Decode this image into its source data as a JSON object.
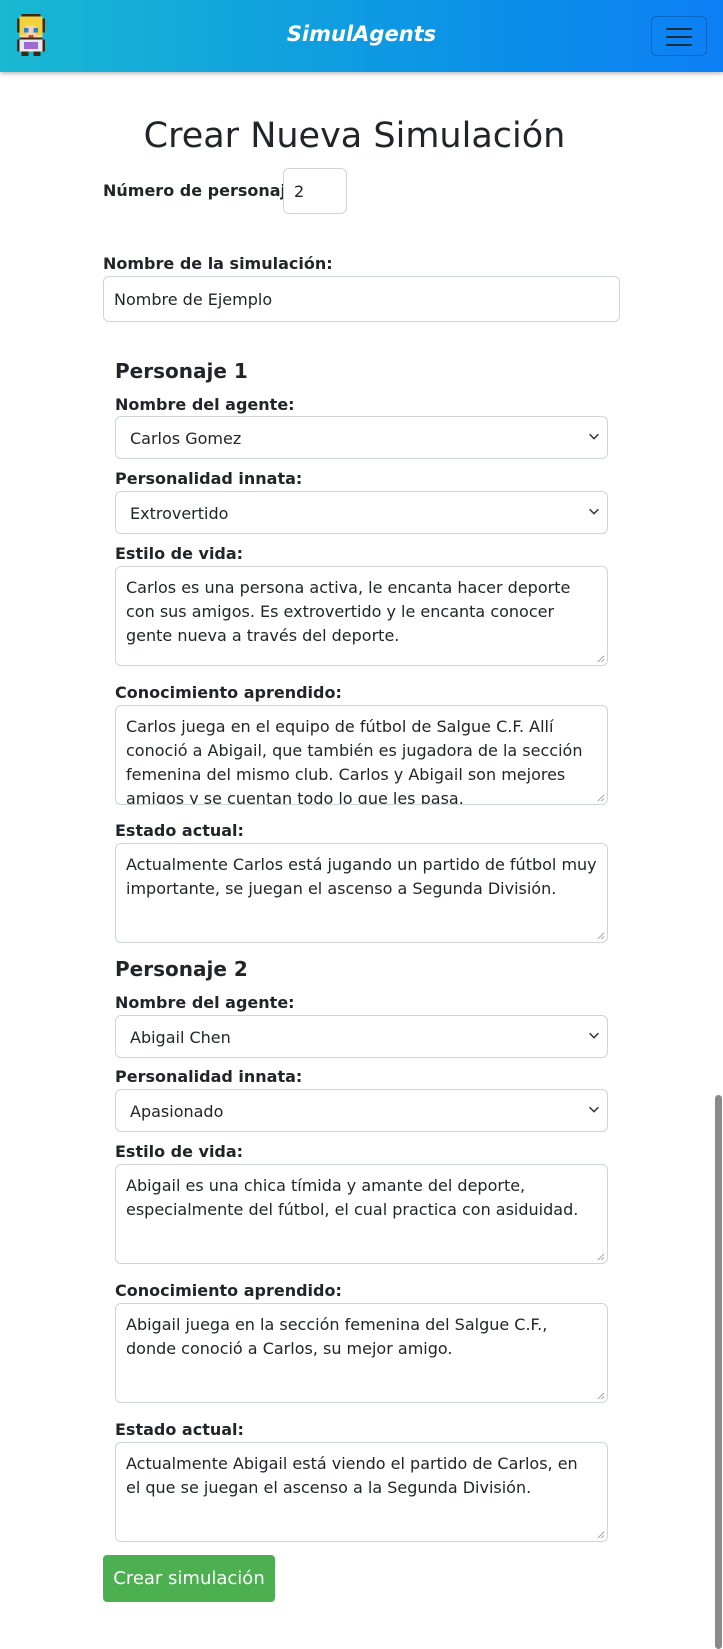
{
  "navbar": {
    "brand": "SimulAgents",
    "logo_icon": "pixel-character-avatar-icon",
    "menu_icon": "hamburger-menu-icon",
    "accent_start": "#1ab8d2",
    "accent_end": "#0d7ff6"
  },
  "page": {
    "title": "Crear Nueva Simulación"
  },
  "form": {
    "count_label": "Número de personajes:",
    "count_value": "2",
    "name_label": "Nombre de la simulación:",
    "name_value": "Nombre de Ejemplo",
    "field_labels": {
      "agent_name": "Nombre del agente:",
      "personality": "Personalidad innata:",
      "lifestyle": "Estilo de vida:",
      "knowledge": "Conocimiento aprendido:",
      "status": "Estado actual:"
    },
    "characters": [
      {
        "title": "Personaje 1",
        "agent_name": "Carlos Gomez",
        "personality": "Extrovertido",
        "lifestyle": "Carlos es una persona activa, le encanta hacer deporte con sus amigos. Es extrovertido y le encanta conocer gente nueva a través del deporte.",
        "knowledge": "Carlos juega en el equipo de fútbol de Salgue C.F. Allí conoció a Abigail, que también es jugadora de la sección femenina del mismo club. Carlos y Abigail son mejores amigos y se cuentan todo lo que les pasa.",
        "status": "Actualmente Carlos está jugando un partido de fútbol muy importante, se juegan el ascenso a Segunda División."
      },
      {
        "title": "Personaje 2",
        "agent_name": "Abigail Chen",
        "personality": "Apasionado",
        "lifestyle": "Abigail es una chica tímida y amante del deporte, especialmente del fútbol, el cual practica con asiduidad.",
        "knowledge": "Abigail juega en la sección femenina del Salgue C.F., donde conoció a Carlos, su mejor amigo.",
        "status": "Actualmente Abigail está viendo el partido de Carlos, en el que se juegan el ascenso a la Segunda División."
      }
    ],
    "submit_label": "Crear simulación",
    "submit_color": "#4caf50"
  }
}
